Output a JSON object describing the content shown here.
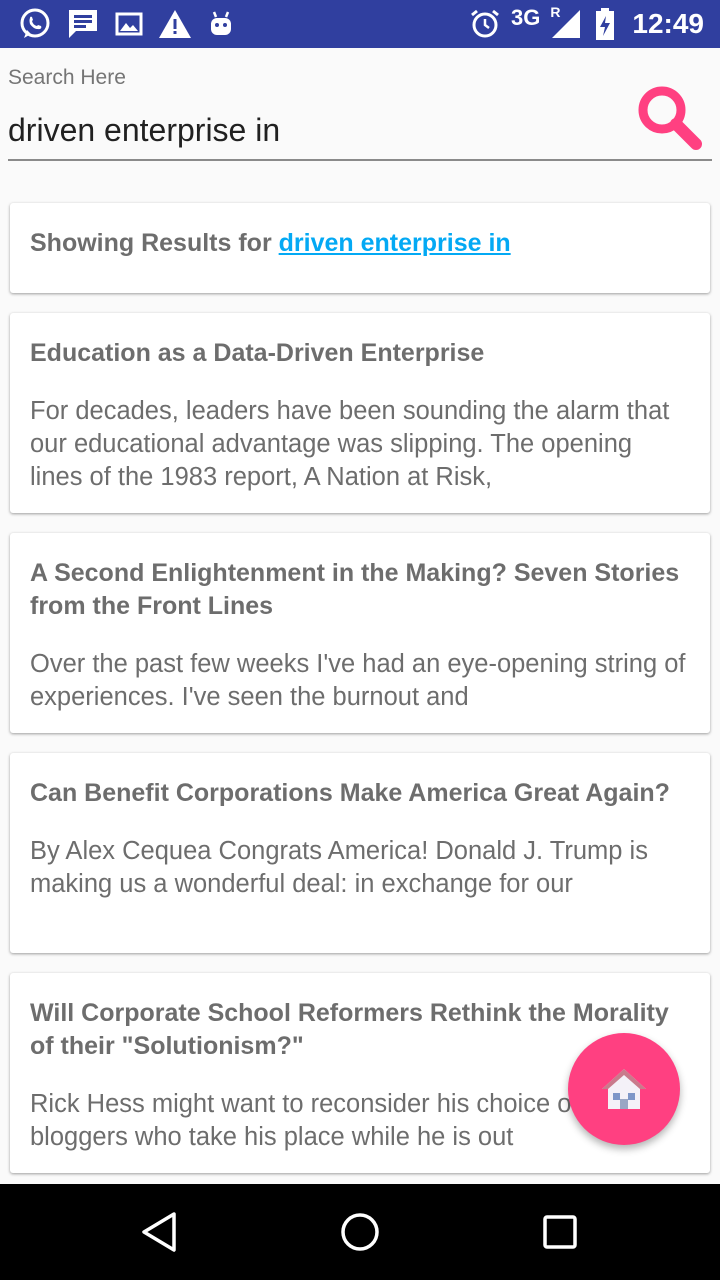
{
  "status_bar": {
    "left_icons": [
      "whatsapp-icon",
      "message-icon",
      "image-icon",
      "warning-icon",
      "android-icon"
    ],
    "right_icons": [
      "alarm-icon",
      "signal-icon",
      "battery-charging-icon"
    ],
    "network": "3G",
    "roaming": "R",
    "time": "12:49"
  },
  "search": {
    "hint": "Search Here",
    "value": "driven enterprise in",
    "button_icon": "search-icon",
    "accent_color": "#ff4081"
  },
  "results_header": {
    "prefix": "Showing Results for",
    "query": "driven enterprise in",
    "link_color": "#03a9f4"
  },
  "articles": [
    {
      "title": "Education as a Data-Driven Enterprise",
      "snippet": "For decades, leaders have been sounding the alarm that our educational advantage was slipping. The opening lines of the 1983 report, A Nation at Risk,"
    },
    {
      "title": "A Second Enlightenment in the Making? Seven Stories from the Front Lines",
      "snippet": "Over the past few weeks I've had an eye-opening string of experiences. I've seen the burnout and"
    },
    {
      "title": "Can Benefit Corporations Make America Great Again?",
      "snippet": "By Alex Cequea Congrats America! Donald J. Trump is making us a wonderful deal: in exchange for our"
    },
    {
      "title": "Will Corporate School Reformers Rethink the Morality of their \"Solutionism?\"",
      "snippet": "Rick Hess might want to reconsider his choice of guest bloggers who take his place while he is out"
    }
  ],
  "fab": {
    "icon": "home-icon",
    "color": "#ff4081"
  },
  "nav_bar": {
    "buttons": [
      "back-icon",
      "home-circle-icon",
      "recents-icon"
    ]
  },
  "colors": {
    "status_bar": "#303f9f",
    "text_gray": "#6d6d6d",
    "background": "#fafafa"
  }
}
